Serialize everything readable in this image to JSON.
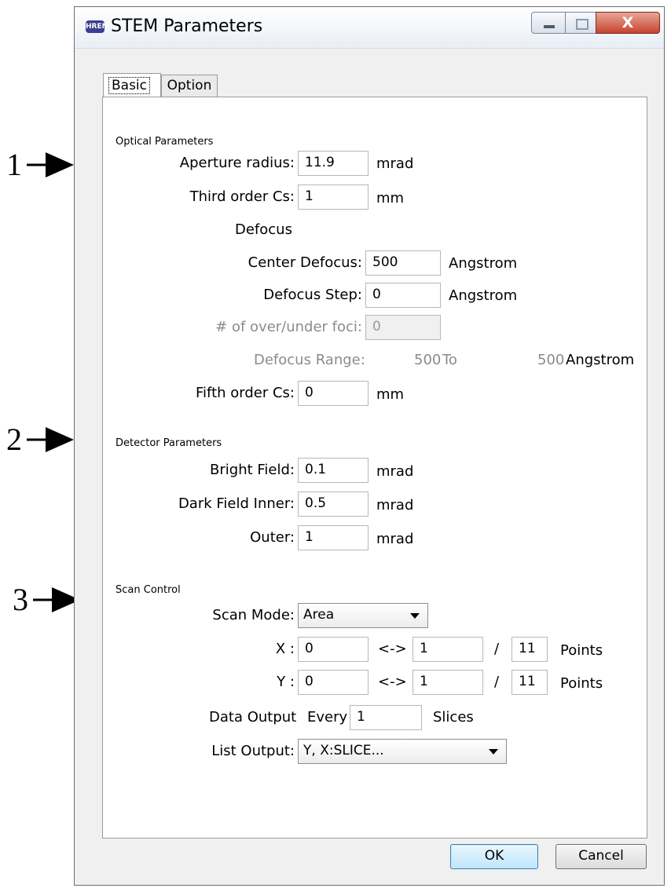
{
  "callouts": [
    "1",
    "2",
    "3"
  ],
  "window": {
    "title": "STEM Parameters",
    "app_icon": "HREM",
    "close_glyph": "X"
  },
  "tabs": [
    "Basic",
    "Option"
  ],
  "optical": {
    "heading": "Optical Parameters",
    "aperture_label": "Aperture radius:",
    "aperture_value": "11.9",
    "aperture_unit": "mrad",
    "cs3_label": "Third order Cs:",
    "cs3_value": "1",
    "cs3_unit": "mm",
    "defocus_heading": "Defocus",
    "center_label": "Center Defocus:",
    "center_value": "500",
    "center_unit": "Angstrom",
    "step_label": "Defocus Step:",
    "step_value": "0",
    "step_unit": "Angstrom",
    "foci_label": "# of over/under foci:",
    "foci_value": "0",
    "range_label": "Defocus Range:",
    "range_from": "500",
    "range_to_word": "To",
    "range_to": "500",
    "range_unit": "Angstrom",
    "cs5_label": "Fifth order Cs:",
    "cs5_value": "0",
    "cs5_unit": "mm"
  },
  "detector": {
    "heading": "Detector Parameters",
    "bf_label": "Bright Field:",
    "bf_value": "0.1",
    "bf_unit": "mrad",
    "dfi_label": "Dark Field Inner:",
    "dfi_value": "0.5",
    "dfi_unit": "mrad",
    "outer_label": "Outer:",
    "outer_value": "1",
    "outer_unit": "mrad"
  },
  "scan": {
    "heading": "Scan Control",
    "mode_label": "Scan Mode:",
    "mode_value": "Area",
    "x_label": "X :",
    "x_from": "0",
    "x_arrow": "<->",
    "x_to": "1",
    "x_slash": "/",
    "x_points": "11",
    "x_unit": "Points",
    "y_label": "Y :",
    "y_from": "0",
    "y_arrow": "<->",
    "y_to": "1",
    "y_slash": "/",
    "y_points": "11",
    "y_unit": "Points",
    "data_output_label": "Data Output",
    "every_label": "Every",
    "every_value": "1",
    "slices_label": "Slices",
    "list_label": "List Output:",
    "list_value": "Y, X:SLICE..."
  },
  "buttons": {
    "ok": "OK",
    "cancel": "Cancel"
  }
}
